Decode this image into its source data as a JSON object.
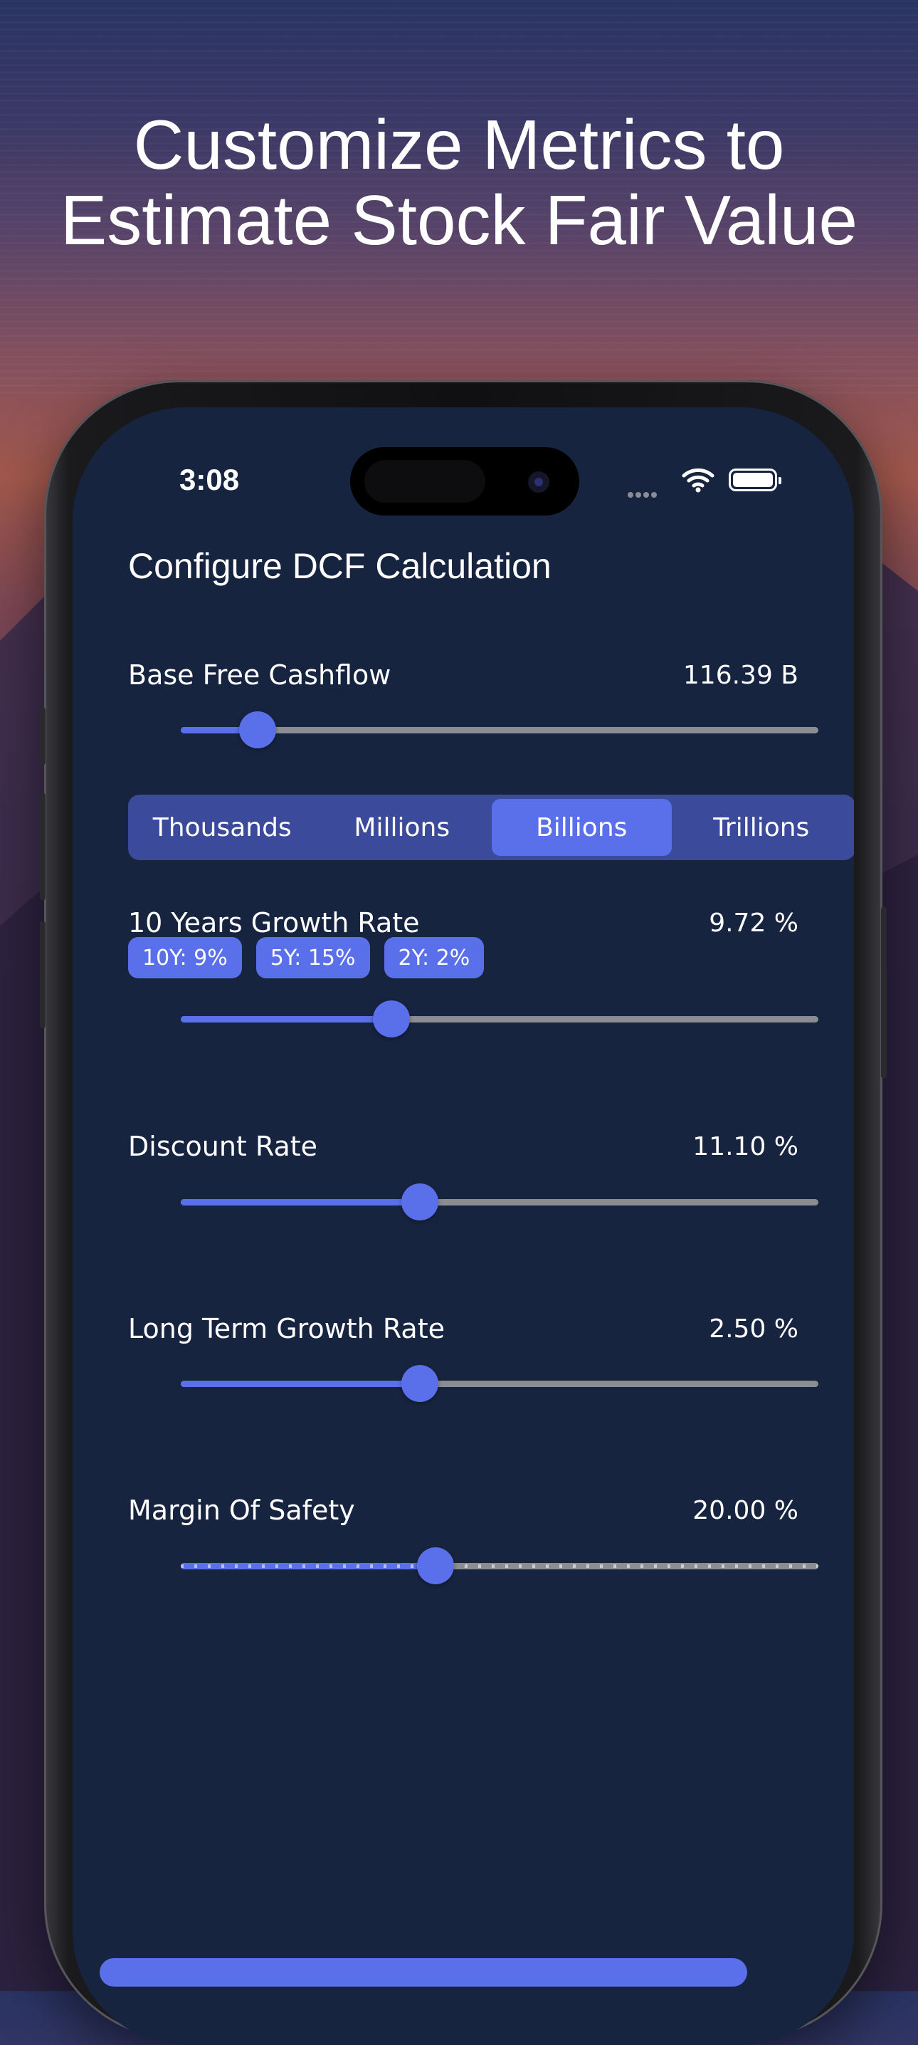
{
  "headline": "Customize Metrics to Estimate Stock Fair Value",
  "status_bar": {
    "time": "3:08"
  },
  "screen_title": "Configure DCF Calculation",
  "base_free_cashflow": {
    "label": "Base Free Cashflow",
    "value": "116.39 B",
    "slider_fraction": 0.12
  },
  "unit_selector": {
    "options": [
      "Thousands",
      "Millions",
      "Billions",
      "Trillions"
    ],
    "selected": "Billions"
  },
  "growth_rate": {
    "label": "10 Years Growth Rate",
    "value": "9.72 %",
    "chips": [
      "10Y: 9%",
      "5Y: 15%",
      "2Y: 2%"
    ],
    "slider_fraction": 0.33
  },
  "discount_rate": {
    "label": "Discount Rate",
    "value": "11.10 %",
    "slider_fraction": 0.375
  },
  "long_term_growth": {
    "label": "Long Term Growth Rate",
    "value": "2.50 %",
    "slider_fraction": 0.375
  },
  "margin_of_safety": {
    "label": "Margin Of Safety",
    "value": "20.00 %",
    "slider_fraction": 0.4
  },
  "colors": {
    "accent": "#5a6fea",
    "screen_bg": "#172440",
    "track": "#8c8d92",
    "segment_bg": "#3b4a9a"
  }
}
